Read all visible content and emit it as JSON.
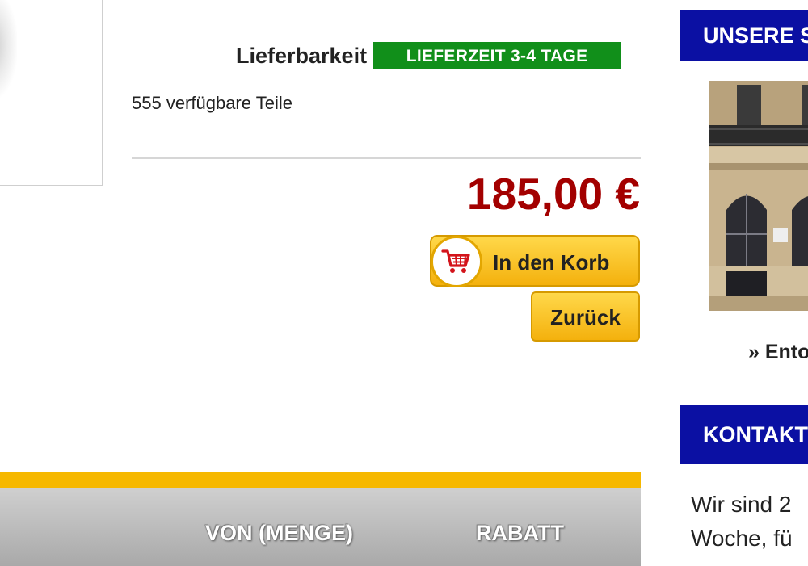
{
  "product": {
    "availability_label": "Lieferbarkeit",
    "availability_badge": "LIEFERZEIT 3-4 TAGE",
    "stock": "555 verfügbare Teile",
    "price": "185,00 €"
  },
  "buttons": {
    "add_to_cart": "In den Korb",
    "back": "Zurück"
  },
  "discount_table": {
    "columns": [
      "VON (MENGE)",
      "RABATT"
    ]
  },
  "sidebar": {
    "stores_title": "UNSERE S",
    "stores_link": "» Ento",
    "contact_title": "KONTAKT",
    "contact_lines": [
      "Wir sind 2",
      "Woche, fü"
    ]
  },
  "colors": {
    "badge_green": "#118f1a",
    "price_red": "#a30000",
    "button_yellow": "#f4b10d",
    "sidebar_blue": "#0b10a3",
    "accent_yellow": "#f6b800"
  },
  "icons": {
    "cart": "shopping-cart-icon"
  }
}
